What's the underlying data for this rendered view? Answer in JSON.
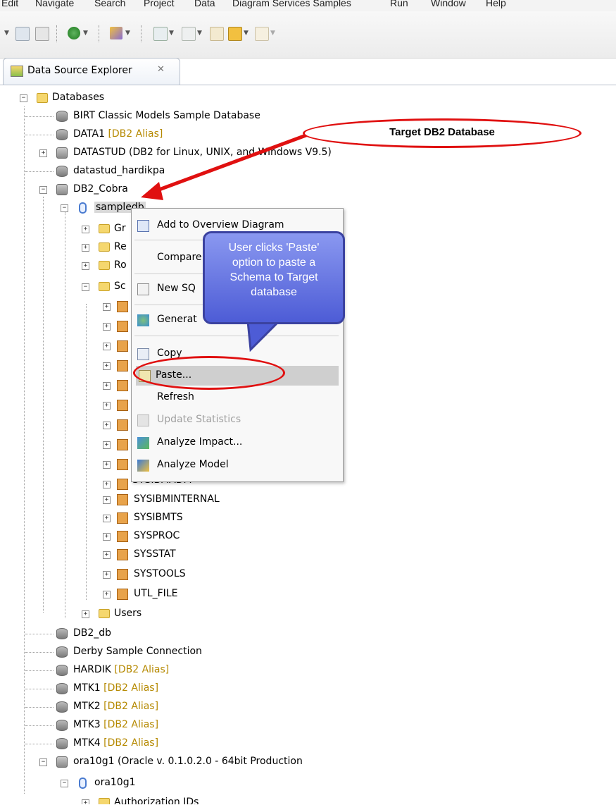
{
  "menubar": [
    "Edit",
    "Navigate",
    "Search",
    "Project",
    "Data",
    "Diagram Services Samples",
    "Run",
    "Window",
    "Help"
  ],
  "view_tab": {
    "title": "Data Source Explorer",
    "close_glyph": "✕"
  },
  "tree": {
    "root": "Databases",
    "items": {
      "birt": "BIRT Classic Models Sample Database",
      "data1": "DATA1",
      "datastud": "DATASTUD (DB2 for Linux, UNIX, and Windows V9.5)",
      "datastud_hardikpa": "datastud_hardikpa",
      "db2_cobra": "DB2_Cobra",
      "sampledb": "sampledb",
      "gr": "Gr",
      "re": "Re",
      "ro": "Ro",
      "sc": "Sc",
      "sysibmadm": "SYSIBMADM",
      "sysibminternal": "SYSIBMINTERNAL",
      "sysibmts": "SYSIBMTS",
      "sysproc": "SYSPROC",
      "sysstat": "SYSSTAT",
      "systools": "SYSTOOLS",
      "utl_file": "UTL_FILE",
      "users": "Users",
      "db2_db": "DB2_db",
      "derby": "Derby Sample Connection",
      "hardik": "HARDIK",
      "mtk1": "MTK1",
      "mtk2": "MTK2",
      "mtk3": "MTK3",
      "mtk4": "MTK4",
      "ora10g1_conn": "ora10g1 (Oracle v. 0.1.0.2.0 - 64bit Production",
      "ora10g1_db": "ora10g1",
      "auth": "Authorization IDs"
    },
    "alias_tag": "[DB2 Alias]"
  },
  "context_menu": {
    "add_overview": "Add to Overview Diagram",
    "compare": "Compare",
    "new_sql": "New SQ",
    "generate": "Generat",
    "copy": "Copy",
    "paste": "Paste...",
    "refresh": "Refresh",
    "update_stats": "Update Statistics",
    "analyze_impact": "Analyze Impact...",
    "analyze_model": "Analyze Model"
  },
  "annotations": {
    "target": "Target DB2 Database",
    "bubble_line1": "User clicks 'Paste'",
    "bubble_line2": "option to paste a",
    "bubble_line3": "Schema to Target",
    "bubble_line4": "database"
  },
  "colors": {
    "alias": "#b58900",
    "highlight_ring": "#e01010",
    "bubble": "#5566dd"
  }
}
